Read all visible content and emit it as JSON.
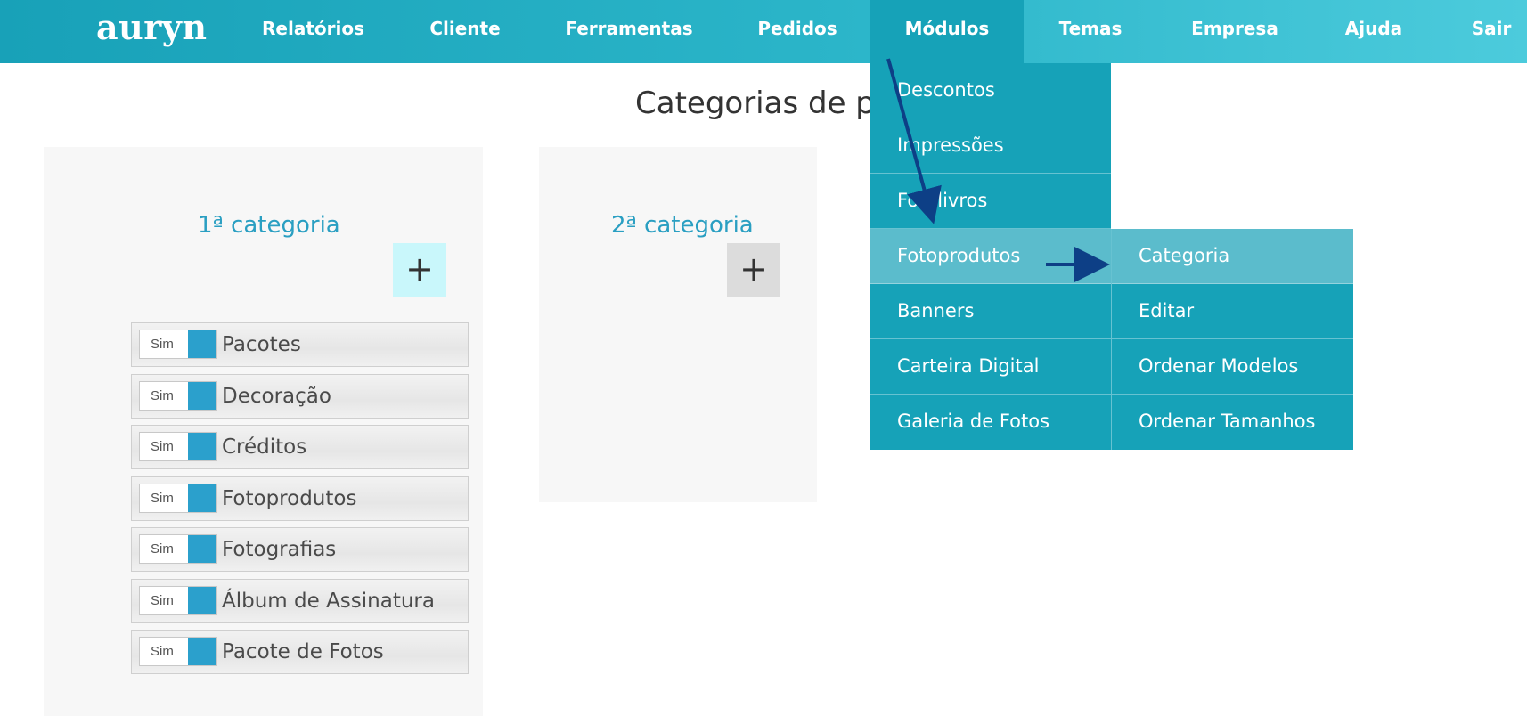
{
  "brand": {
    "logo": "auryn"
  },
  "nav": [
    {
      "label": "Relatórios"
    },
    {
      "label": "Cliente"
    },
    {
      "label": "Ferramentas"
    },
    {
      "label": "Pedidos"
    },
    {
      "label": "Módulos",
      "active": true
    },
    {
      "label": "Temas"
    },
    {
      "label": "Empresa"
    },
    {
      "label": "Ajuda"
    },
    {
      "label": "Sair"
    }
  ],
  "page": {
    "title": "Categorias de pr"
  },
  "panels": {
    "first": {
      "title": "1ª categoria",
      "add_symbol": "+",
      "items": [
        {
          "toggle": "Sim",
          "label": "Pacotes"
        },
        {
          "toggle": "Sim",
          "label": "Decoração"
        },
        {
          "toggle": "Sim",
          "label": "Créditos"
        },
        {
          "toggle": "Sim",
          "label": "Fotoprodutos"
        },
        {
          "toggle": "Sim",
          "label": "Fotografias"
        },
        {
          "toggle": "Sim",
          "label": "Álbum de Assinatura"
        },
        {
          "toggle": "Sim",
          "label": "Pacote de Fotos"
        }
      ]
    },
    "second": {
      "title": "2ª categoria",
      "add_symbol": "+"
    }
  },
  "modulos_menu": [
    {
      "label": "Descontos"
    },
    {
      "label": "Impressões"
    },
    {
      "label": "Fotolivros"
    },
    {
      "label": "Fotoprodutos",
      "highlighted": true
    },
    {
      "label": "Banners"
    },
    {
      "label": "Carteira Digital"
    },
    {
      "label": "Galeria de Fotos"
    }
  ],
  "fotoprodutos_submenu": [
    {
      "label": "Categoria",
      "highlighted": true
    },
    {
      "label": "Editar"
    },
    {
      "label": "Ordenar Modelos"
    },
    {
      "label": "Ordenar Tamanhos"
    }
  ],
  "colors": {
    "nav_start": "#18a1b8",
    "nav_end": "#4ccbdc",
    "menu": "#16a2b8",
    "menu_hover": "#5bbccc",
    "accent_title": "#2a9fc2",
    "toggle_on": "#2ba0cc",
    "annotation_arrow": "#0d3f86",
    "add_btn_active": "#c9f7fb",
    "add_btn_default": "#dcdcdc"
  }
}
